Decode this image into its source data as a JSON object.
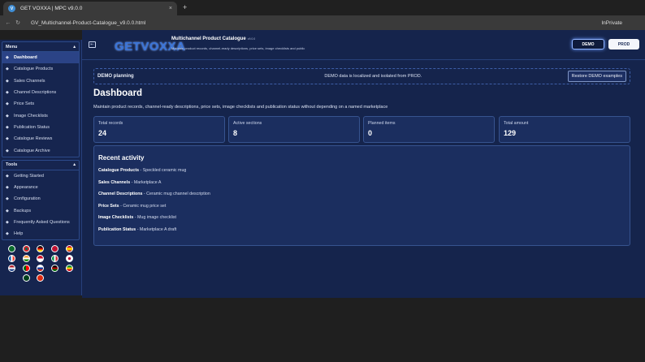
{
  "browser": {
    "tab_title": "GET VOXXA | MPC v9.0.0",
    "tab_close": "×",
    "new_tab": "+",
    "url": "GV_Multichannel-Product-Catalogue_v9.0.0.html",
    "mode": "InPrivate",
    "favicon": "V"
  },
  "sidebar": {
    "menu_title": "Menu",
    "menu_items": [
      {
        "label": "Dashboard",
        "icon": "home-icon",
        "active": true
      },
      {
        "label": "Catalogue Products",
        "icon": "box-icon"
      },
      {
        "label": "Sales Channels",
        "icon": "channel-icon"
      },
      {
        "label": "Channel Descriptions",
        "icon": "text-icon"
      },
      {
        "label": "Price Sets",
        "icon": "tag-icon"
      },
      {
        "label": "Image Checklists",
        "icon": "image-icon"
      },
      {
        "label": "Publication Status",
        "icon": "status-icon"
      },
      {
        "label": "Catalogue Reviews",
        "icon": "review-icon"
      },
      {
        "label": "Catalogue Archive",
        "icon": "archive-icon"
      }
    ],
    "tools_title": "Tools",
    "tool_items": [
      {
        "label": "Getting Started",
        "icon": "rocket-icon"
      },
      {
        "label": "Appearance",
        "icon": "palette-icon"
      },
      {
        "label": "Configuration",
        "icon": "gear-icon"
      },
      {
        "label": "Backups",
        "icon": "backup-icon"
      },
      {
        "label": "Frequently Asked Questions",
        "icon": "question-icon"
      },
      {
        "label": "Help",
        "icon": "help-icon"
      }
    ]
  },
  "header": {
    "logo_a": "GET",
    "logo_b": "VOXXA",
    "title": "Multichannel Product Catalogue",
    "version": "v9.0.0",
    "subtitle": "Maintain product records, channel-ready descriptions, price sets, image checklists and public",
    "demo_label": "DEMO",
    "prod_label": "PROD"
  },
  "banner": {
    "label": "DEMO planning",
    "message": "DEMO data is localized and isolated from PROD.",
    "restore_label": "Restore DEMO examples"
  },
  "dashboard": {
    "title": "Dashboard",
    "subtitle": "Maintain product records, channel-ready descriptions, price sets, image checklists and publication status without depending on a named marketplace",
    "stats": [
      {
        "label": "Total records",
        "value": "24"
      },
      {
        "label": "Active sections",
        "value": "8"
      },
      {
        "label": "Planned items",
        "value": "0"
      },
      {
        "label": "Total amount",
        "value": "129"
      }
    ],
    "activity_title": "Recent activity",
    "activity": [
      {
        "section": "Catalogue Products",
        "detail": " - Speckled ceramic mug"
      },
      {
        "section": "Sales Channels",
        "detail": " - Marketplace A"
      },
      {
        "section": "Channel Descriptions",
        "detail": " - Ceramic mug channel description"
      },
      {
        "section": "Price Sets",
        "detail": " - Ceramic mug price set"
      },
      {
        "section": "Image Checklists",
        "detail": " - Mug image checklist"
      },
      {
        "section": "Publication Status",
        "detail": " - Marketplace A draft"
      }
    ]
  },
  "colors": {
    "sidebar_bg": "#16254f",
    "main_bg": "#15244c",
    "card_bg": "#1b2e5f",
    "accent": "#8fb3ff"
  }
}
